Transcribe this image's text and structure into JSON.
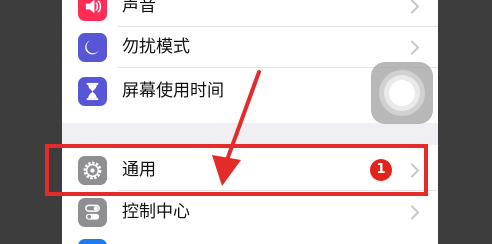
{
  "settings": {
    "rows": [
      {
        "label": "声音",
        "icon": "speaker-icon",
        "color": "#ff2d55"
      },
      {
        "label": "勿扰模式",
        "icon": "moon-icon",
        "color": "#5856d6"
      },
      {
        "label": "屏幕使用时间",
        "icon": "hourglass-icon",
        "color": "#5856d6"
      },
      {
        "label": "通用",
        "icon": "gear-icon",
        "color": "#8e8e93",
        "badge": "1"
      },
      {
        "label": "控制中心",
        "icon": "toggle-switches-icon",
        "color": "#8e8e93"
      }
    ]
  },
  "colors": {
    "highlight": "#e52a2a",
    "badge": "#e2231a",
    "dark_background": "#3d3d3d"
  }
}
